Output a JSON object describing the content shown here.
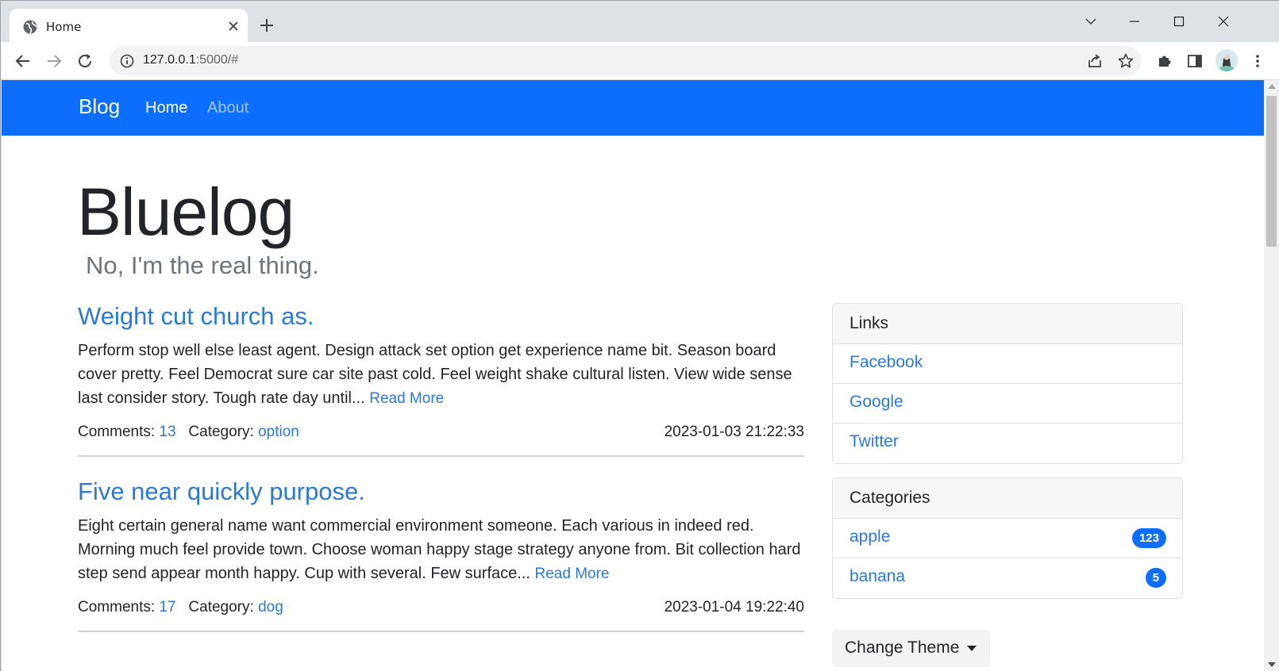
{
  "browser": {
    "tab_title": "Home",
    "url_host": "127.0.0.1",
    "url_path": ":5000/#"
  },
  "navbar": {
    "brand": "Blog",
    "links": [
      {
        "label": "Home",
        "active": true
      },
      {
        "label": "About",
        "active": false
      }
    ]
  },
  "hero": {
    "title": "Bluelog",
    "subtitle": "No, I'm the real thing."
  },
  "posts": [
    {
      "title": "Weight cut church as.",
      "body": "Perform stop well else least agent. Design attack set option get experience name bit. Season board cover pretty. Feel Democrat sure car site past cold. Feel weight shake cultural listen. View wide sense last consider story. Tough rate day until...",
      "read_more": "Read More",
      "comments_label": "Comments:",
      "comments": "13",
      "category_label": "Category:",
      "category": "option",
      "date": "2023-01-03 21:22:33"
    },
    {
      "title": "Five near quickly purpose.",
      "body": "Eight certain general name want commercial environment someone. Each various in indeed red. Morning much feel provide town. Choose woman happy stage strategy anyone from. Bit collection hard step send appear month happy. Cup with several. Few surface...",
      "read_more": "Read More",
      "comments_label": "Comments:",
      "comments": "17",
      "category_label": "Category:",
      "category": "dog",
      "date": "2023-01-04 19:22:40"
    }
  ],
  "sidebar": {
    "links_card": {
      "header": "Links",
      "items": [
        "Facebook",
        "Google",
        "Twitter"
      ]
    },
    "categories_card": {
      "header": "Categories",
      "items": [
        {
          "name": "apple",
          "count": "123"
        },
        {
          "name": "banana",
          "count": "5"
        }
      ]
    },
    "theme_button": "Change Theme"
  },
  "colors": {
    "primary": "#0d6efd",
    "link": "#2a79d6"
  }
}
